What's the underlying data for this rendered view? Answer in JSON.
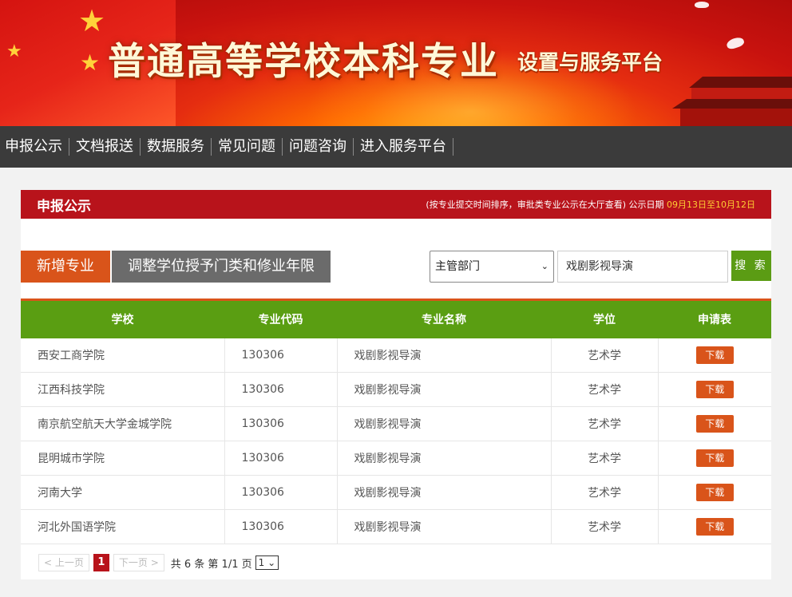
{
  "banner": {
    "title": "普通高等学校本科专业",
    "subtitle": "设置与服务平台"
  },
  "nav": {
    "items": [
      "申报公示",
      "文档报送",
      "数据服务",
      "常见问题",
      "问题咨询",
      "进入服务平台"
    ]
  },
  "section": {
    "heading": "申报公示",
    "note_prefix": "(按专业提交时间排序，审批类专业公示在大厅查看) 公示日期 ",
    "note_date": "09月13日至10月12日"
  },
  "tabs": {
    "new_major": "新增专业",
    "adjust": "调整学位授予门类和修业年限"
  },
  "search": {
    "select_value": "主管部门",
    "input_value": "戏剧影视导演",
    "button_label": "搜 索"
  },
  "table": {
    "headers": [
      "学校",
      "专业代码",
      "专业名称",
      "学位",
      "申请表"
    ],
    "download_label": "下载",
    "rows": [
      {
        "school": "西安工商学院",
        "code": "130306",
        "name": "戏剧影视导演",
        "degree": "艺术学"
      },
      {
        "school": "江西科技学院",
        "code": "130306",
        "name": "戏剧影视导演",
        "degree": "艺术学"
      },
      {
        "school": "南京航空航天大学金城学院",
        "code": "130306",
        "name": "戏剧影视导演",
        "degree": "艺术学"
      },
      {
        "school": "昆明城市学院",
        "code": "130306",
        "name": "戏剧影视导演",
        "degree": "艺术学"
      },
      {
        "school": "河南大学",
        "code": "130306",
        "name": "戏剧影视导演",
        "degree": "艺术学"
      },
      {
        "school": "河北外国语学院",
        "code": "130306",
        "name": "戏剧影视导演",
        "degree": "艺术学"
      }
    ]
  },
  "pager": {
    "prev": "< 上一页",
    "current": "1",
    "next": "下一页 >",
    "info": "共 6 条 第 1/1 页",
    "select_value": "1"
  },
  "colors": {
    "banner_red": "#c8120e",
    "nav_bg": "#3b3b3b",
    "section_red": "#b8131b",
    "accent_orange": "#d9541a",
    "table_green": "#5a9e12"
  }
}
